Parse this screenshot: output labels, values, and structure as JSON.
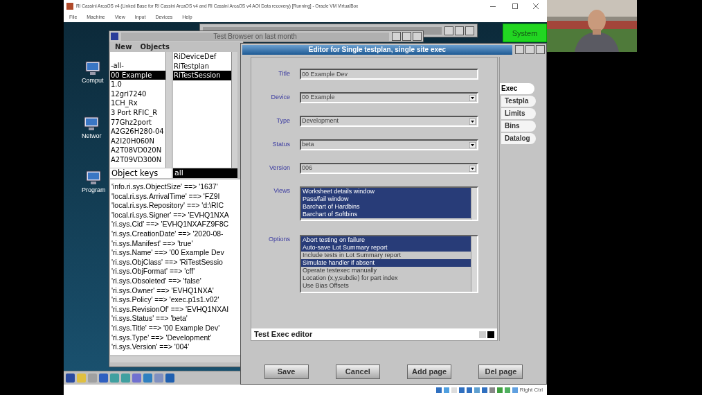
{
  "vbox": {
    "title": "RI Cassini ArcaOS v4 (Linked Base for RI Cassini ArcaOS v4 and RI Cassini ArcaOS v4 AOI Data recovery) [Running] - Oracle VM VirtualBox",
    "menu": [
      "File",
      "Machine",
      "View",
      "Input",
      "Devices",
      "Help"
    ],
    "host_key": "Right Ctrl"
  },
  "desktop_icons": [
    {
      "label": "Comput"
    },
    {
      "label": "Networ"
    },
    {
      "label": "Program"
    }
  ],
  "system_button": "System",
  "browser": {
    "title": "Test Browser on last month",
    "menu": [
      "New",
      "Objects"
    ],
    "list_1": [
      {
        "label": "-all-",
        "selected": false
      },
      {
        "label": "00 Example",
        "selected": true
      },
      {
        "label": "1.0",
        "selected": false
      },
      {
        "label": "12gri7240",
        "selected": false
      },
      {
        "label": "1CH_Rx",
        "selected": false
      },
      {
        "label": "3 Port RFIC_R",
        "selected": false
      },
      {
        "label": "77Ghz2port",
        "selected": false
      },
      {
        "label": "A2G26H280-04",
        "selected": false
      },
      {
        "label": "A2I20H060N",
        "selected": false
      },
      {
        "label": "A2T08VD020N",
        "selected": false
      },
      {
        "label": "A2T09VD300N",
        "selected": false
      }
    ],
    "list_2": [
      {
        "label": "RiDeviceDef",
        "selected": false
      },
      {
        "label": "RiTestplan",
        "selected": false
      },
      {
        "label": "RiTestSession",
        "selected": true
      }
    ],
    "keys_label": "Object keys",
    "keys_filter": "all",
    "keys": [
      "'info.ri.sys.ObjectSize' ==> '1637'",
      "'local.ri.sys.ArrivalTime' ==> 'FZ9I",
      "'local.ri.sys.Repository' ==> 'd:\\RIC",
      "'local.ri.sys.Signer' ==> 'EVHQ1NXA",
      "'ri.sys.Cid' ==> 'EVHQ1NXAFZ9F8C",
      "'ri.sys.CreationDate' ==> '2020-08-",
      "'ri.sys.Manifest' ==> 'true'",
      "'ri.sys.Name' ==> '00 Example Dev",
      "'ri.sys.ObjClass' ==> 'RiTestSessio",
      "'ri.sys.ObjFormat' ==> 'cff'",
      "'ri.sys.Obsoleted' ==> 'false'",
      "'ri.sys.Owner' ==> 'EVHQ1NXA'",
      "'ri.sys.Policy' ==> 'exec.p1s1.v02'",
      "'ri.sys.RevisionOf' ==> 'EVHQ1NXAI",
      "'ri.sys.Status' ==> 'beta'",
      "'ri.sys.Title' ==> '00 Example Dev'",
      "'ri.sys.Type' ==> 'Development'",
      "'ri.sys.Version' ==> '004'"
    ]
  },
  "editor": {
    "title": "Editor for Single testplan, single site exec",
    "fields": [
      {
        "label": "Title",
        "value": "00 Example Dev",
        "kind": "text"
      },
      {
        "label": "Device",
        "value": "00 Example",
        "kind": "dropdown"
      },
      {
        "label": "Type",
        "value": "Development",
        "kind": "dropdown"
      },
      {
        "label": "Status",
        "value": "beta",
        "kind": "dropdown"
      },
      {
        "label": "Version",
        "value": "006",
        "kind": "dropdown"
      }
    ],
    "views": {
      "label": "Views",
      "items": [
        {
          "label": "Worksheet details window",
          "selected": true
        },
        {
          "label": "Pass/fail window",
          "selected": true
        },
        {
          "label": "Barchart of Hardbins",
          "selected": true
        },
        {
          "label": "Barchart of Softbins",
          "selected": true
        }
      ]
    },
    "options": {
      "label": "Options",
      "items": [
        {
          "label": "Abort testing on failure",
          "selected": true
        },
        {
          "label": "Auto-save Lot Summary report",
          "selected": true
        },
        {
          "label": "Include tests in Lot Summary report",
          "selected": false
        },
        {
          "label": "Simulate handler if absent",
          "selected": true
        },
        {
          "label": "Operate testexec manually",
          "selected": false
        },
        {
          "label": "Location (x,y,subdie) for part index",
          "selected": false
        },
        {
          "label": "Use Bias Offsets",
          "selected": false
        }
      ]
    },
    "tabs": [
      {
        "label": "Exec",
        "selected": true
      },
      {
        "label": "Testpla",
        "selected": false
      },
      {
        "label": "Limits",
        "selected": false
      },
      {
        "label": "Bins",
        "selected": false
      },
      {
        "label": "Datalog",
        "selected": false
      }
    ],
    "status": "Test Exec editor",
    "buttons": [
      "Save",
      "Cancel",
      "Add page",
      "Del page"
    ]
  }
}
